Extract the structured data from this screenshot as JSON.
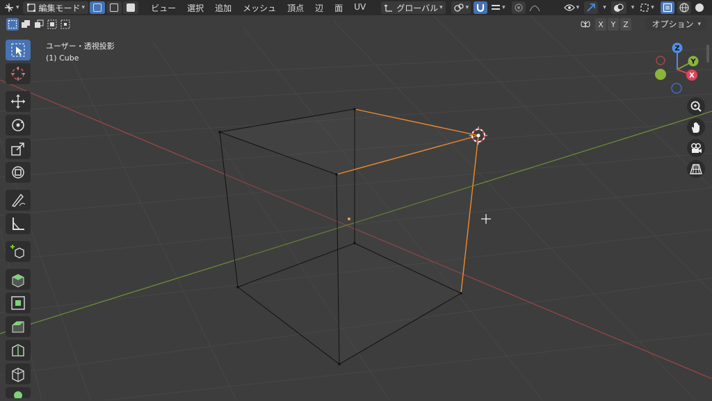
{
  "header": {
    "mode_label": "編集モード",
    "menu": [
      "ビュー",
      "選択",
      "追加",
      "メッシュ",
      "頂点",
      "辺",
      "面",
      "UV"
    ],
    "transform_orientation": "グローバル"
  },
  "secondary_header": {
    "axes": [
      "X",
      "Y",
      "Z"
    ],
    "options_label": "オプション"
  },
  "viewport": {
    "view_name": "ユーザー・透視投影",
    "object_label": "(1) Cube"
  },
  "gizmo": {
    "x": "X",
    "y": "Y",
    "z": "Z"
  },
  "colors": {
    "selected_edge": "#f08a2a",
    "x_axis": "#c94a4f",
    "y_axis": "#7ea33a",
    "accent": "#4772b3"
  },
  "icons": {
    "tools": [
      "select-box-icon",
      "cursor-icon",
      "move-icon",
      "rotate-icon",
      "scale-icon",
      "transform-icon",
      "annotate-icon",
      "measure-icon",
      "add-cube-icon",
      "extrude-icon",
      "inset-icon",
      "bevel-icon",
      "loop-cut-icon",
      "knife-icon",
      "poly-build-icon"
    ],
    "nav": [
      "zoom-icon",
      "pan-hand-icon",
      "camera-icon",
      "grid-perspective-icon"
    ]
  }
}
